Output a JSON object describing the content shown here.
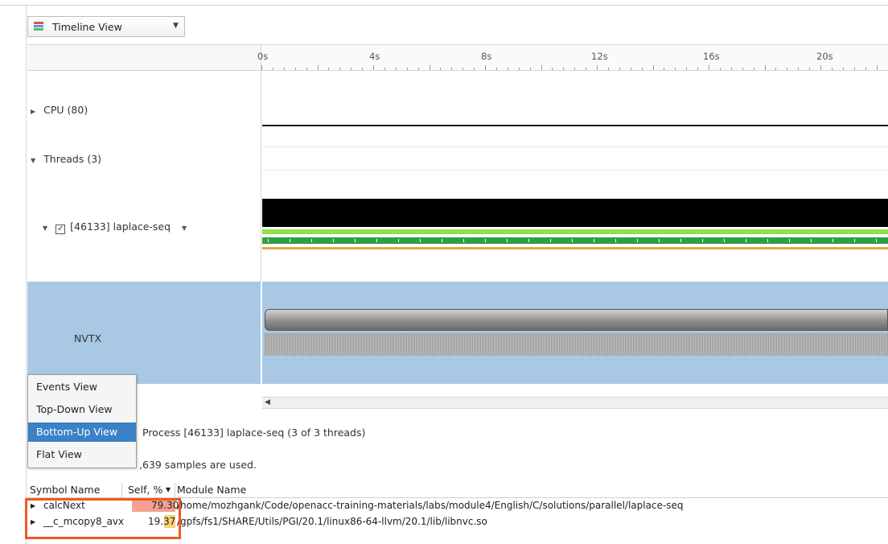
{
  "view_selector": {
    "label": "Timeline View"
  },
  "ruler": {
    "ticks": [
      "0s",
      "4s",
      "8s",
      "12s",
      "16s",
      "20s"
    ]
  },
  "rows": {
    "cpu": "CPU (80)",
    "threads": "Threads (3)",
    "thread": "[46133] laplace-seq",
    "nvtx": "NVTX"
  },
  "menu": {
    "items": [
      "Events View",
      "Top-Down View",
      "Bottom-Up View",
      "Flat View"
    ],
    "selected": "Bottom-Up View"
  },
  "info": {
    "process": "Process [46133] laplace-seq (3 of 3 threads)",
    "samples": ",639 samples are used."
  },
  "table": {
    "headers": [
      "Symbol Name",
      "Self, %",
      "Module Name"
    ],
    "rows": [
      {
        "symbol": "calcNext",
        "self": "79.30",
        "module": "/home/mozhgank/Code/openacc-training-materials/labs/module4/English/C/solutions/parallel/laplace-seq",
        "bar_color": "#f4a193"
      },
      {
        "symbol": "__c_mcopy8_avx",
        "self": "19.37",
        "module": "/gpfs/fs1/SHARE/Utils/PGI/20.1/linux86-64-llvm/20.1/lib/libnvc.so",
        "bar_color": "#f8d27a"
      }
    ]
  },
  "colors": {
    "nvtx_bg": "#a8c8e4",
    "menu_active": "#3a82c4",
    "highlight": "#f05a1e",
    "trace_green_light": "#8ee04a",
    "trace_green_dark": "#2f9e44",
    "trace_orange": "#e0a84a"
  }
}
